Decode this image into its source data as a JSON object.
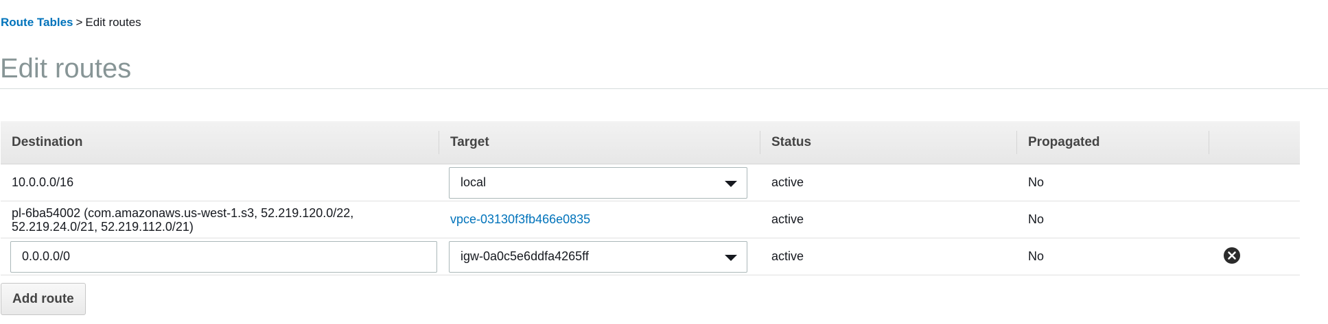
{
  "breadcrumb": {
    "parent_label": "Route Tables",
    "separator": ">",
    "current_label": "Edit routes"
  },
  "page": {
    "title": "Edit routes"
  },
  "table": {
    "columns": [
      "Destination",
      "Target",
      "Status",
      "Propagated",
      ""
    ],
    "rows": [
      {
        "destination": "10.0.0.0/16",
        "destination_editable": false,
        "target": "local",
        "target_kind": "select",
        "status": "active",
        "propagated": "No",
        "removable": false
      },
      {
        "destination": "pl-6ba54002 (com.amazonaws.us-west-1.s3, 52.219.120.0/22, 52.219.24.0/21, 52.219.112.0/21)",
        "destination_editable": false,
        "target": "vpce-03130f3fb466e0835",
        "target_kind": "link",
        "status": "active",
        "propagated": "No",
        "removable": false
      },
      {
        "destination": "0.0.0.0/0",
        "destination_editable": true,
        "target": "igw-0a0c5e6ddfa4265ff",
        "target_kind": "select",
        "status": "active",
        "propagated": "No",
        "removable": true,
        "remove_icon": "circle-x-icon"
      }
    ]
  },
  "actions": {
    "add_route_label": "Add route"
  },
  "colors": {
    "link": "#0073bb",
    "status_active": "#1d8102",
    "title": "#879596",
    "header_bg": "#ebebeb"
  }
}
